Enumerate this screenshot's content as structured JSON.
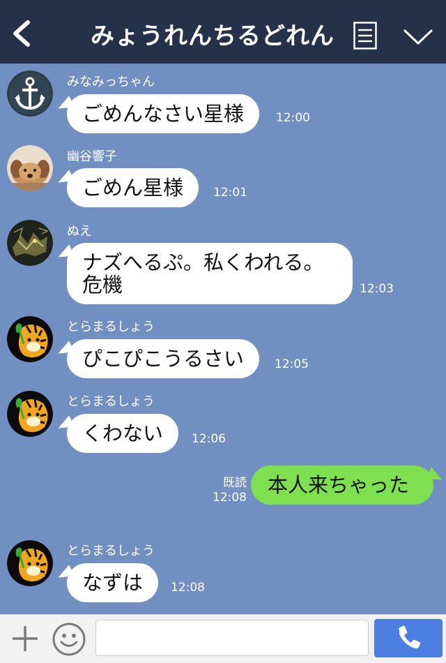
{
  "header": {
    "title": "みょうれんちるどれん",
    "background": "#253049"
  },
  "messages": [
    {
      "sender": "みなみっちゃん",
      "text": "ごめんなさい星様",
      "time": "12:00",
      "avatar": "anchor-avatar"
    },
    {
      "sender": "幽谷響子",
      "text": "ごめん星様",
      "time": "12:01",
      "avatar": "puppy-avatar"
    },
    {
      "sender": "ぬえ",
      "text": "ナズへるぷ。私くわれる。危機",
      "time": "12:03",
      "avatar": "creature-avatar"
    },
    {
      "sender": "とらまるしょう",
      "text": "ぴこぴこうるさい",
      "time": "12:05",
      "avatar": "tiger-avatar"
    },
    {
      "sender": "とらまるしょう",
      "text": "くわない",
      "time": "12:06",
      "avatar": "tiger-avatar"
    },
    {
      "sender": "me",
      "text": "本人来ちゃった",
      "time": "12:08",
      "read_label": "既読"
    },
    {
      "sender": "とらまるしょう",
      "text": "なずは",
      "time": "12:08",
      "avatar": "tiger-avatar"
    }
  ],
  "composer": {
    "placeholder": ""
  },
  "colors": {
    "chat_background": "#7190c1",
    "incoming_bubble": "#ffffff",
    "outgoing_bubble": "#7fe04f",
    "call_button": "#4b7ee0"
  }
}
